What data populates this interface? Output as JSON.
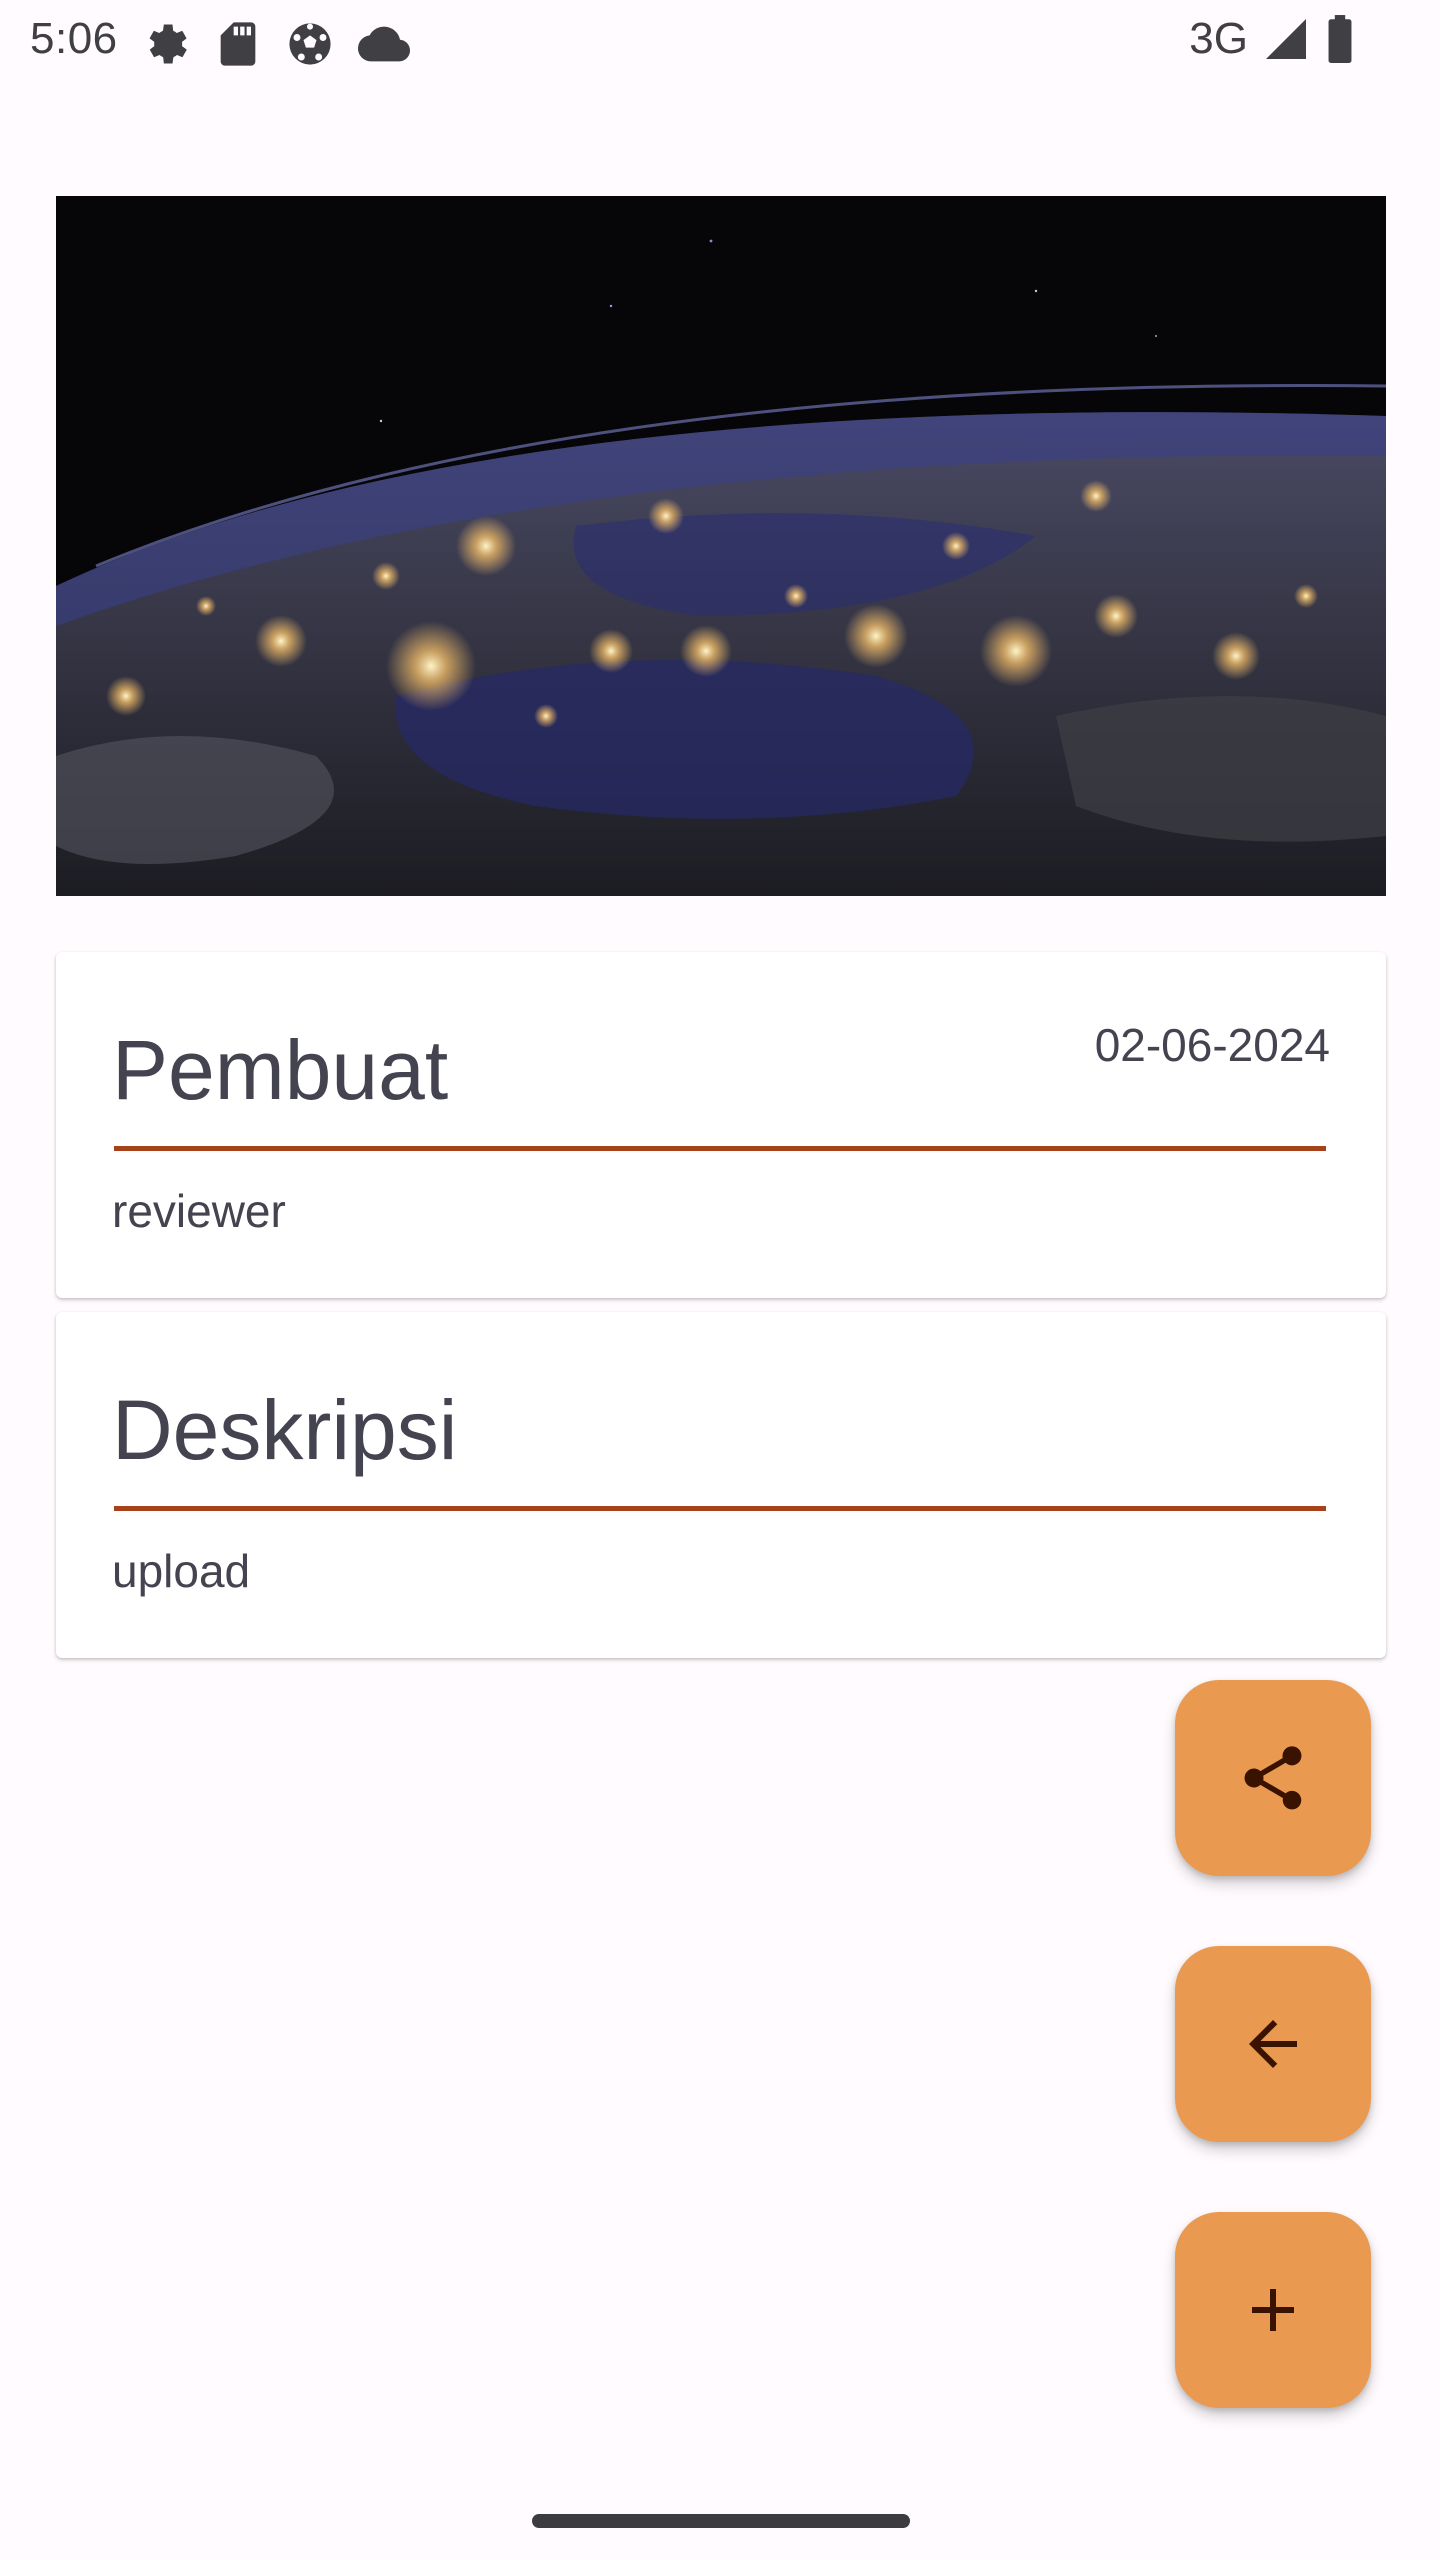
{
  "status_bar": {
    "time": "5:06",
    "network": "3G",
    "left_icons": [
      "settings-icon",
      "sd-card-icon",
      "soccer-ball-icon",
      "cloud-icon"
    ],
    "right_icons": [
      "signal-icon",
      "battery-icon"
    ]
  },
  "hero_image": {
    "description_icon": "earth-at-night-image"
  },
  "author_card": {
    "title": "Pembuat",
    "date": "02-06-2024",
    "value": "reviewer"
  },
  "description_card": {
    "title": "Deskripsi",
    "value": "upload"
  },
  "fabs": {
    "share_icon": "share-icon",
    "back_icon": "arrow-back-icon",
    "add_icon": "add-icon"
  },
  "colors": {
    "background": "#fffbfe",
    "fab": "#ea9950",
    "divider": "#a5421a",
    "text": "#444350"
  }
}
